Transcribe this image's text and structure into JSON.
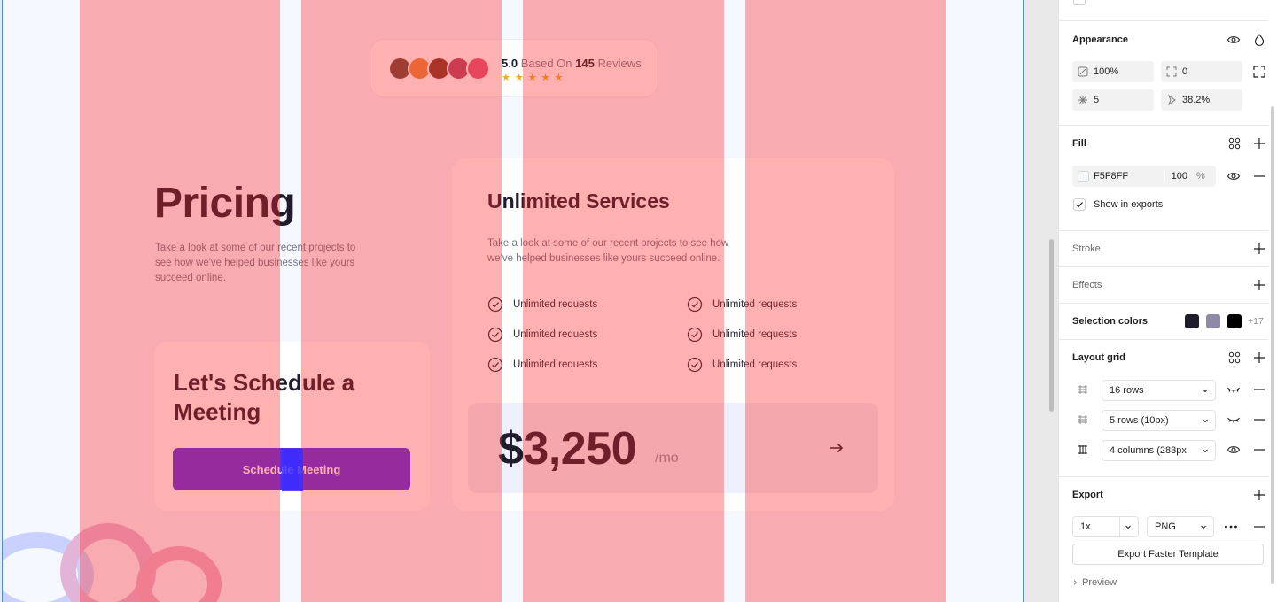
{
  "canvas": {
    "reviews": {
      "rating": "5.0",
      "based_on_label": "Based On",
      "count": "145",
      "reviews_label": "Reviews",
      "stars": "★★★★★"
    },
    "pricing": {
      "title": "Pricing",
      "description": "Take a look at some of our recent projects to see how we've helped businesses like yours succeed online."
    },
    "meeting": {
      "title": "Let's Schedule a Meeting",
      "button_label": "Schedule Meeting"
    },
    "services": {
      "title": "Unlimited Services",
      "description": "Take a look at some of our recent projects to see how we've helped businesses like yours succeed online.",
      "features": [
        "Unlimited requests",
        "Unlimited requests",
        "Unlimited requests",
        "Unlimited requests",
        "Unlimited requests",
        "Unlimited requests"
      ],
      "price": "$3,250",
      "price_unit": "/mo",
      "arrow": "→"
    }
  },
  "panel": {
    "appearance": {
      "title": "Appearance",
      "opacity": "100%",
      "corner_radius": "0",
      "points": "5",
      "ratio": "38.2%"
    },
    "fill": {
      "title": "Fill",
      "hex": "F5F8FF",
      "opacity": "100",
      "percent": "%",
      "show_in_exports": "Show in exports"
    },
    "stroke": {
      "title": "Stroke"
    },
    "effects": {
      "title": "Effects"
    },
    "selection_colors": {
      "title": "Selection colors",
      "swatches": [
        "#1f1c2c",
        "#8e8aa6",
        "#000000"
      ],
      "more": "+17"
    },
    "layout_grid": {
      "title": "Layout grid",
      "grids": [
        "16 rows",
        "5 rows (10px)",
        "4 columns (283px"
      ]
    },
    "export": {
      "title": "Export",
      "scale": "1x",
      "format": "PNG",
      "button_label": "Export Faster Template",
      "preview": "Preview"
    }
  },
  "colors": {
    "frame_fill": "#F5F8FF",
    "accent": "#5b2ee0",
    "grid_overlay": "rgba(255,40,40,0.36)",
    "star": "#f5a623"
  }
}
